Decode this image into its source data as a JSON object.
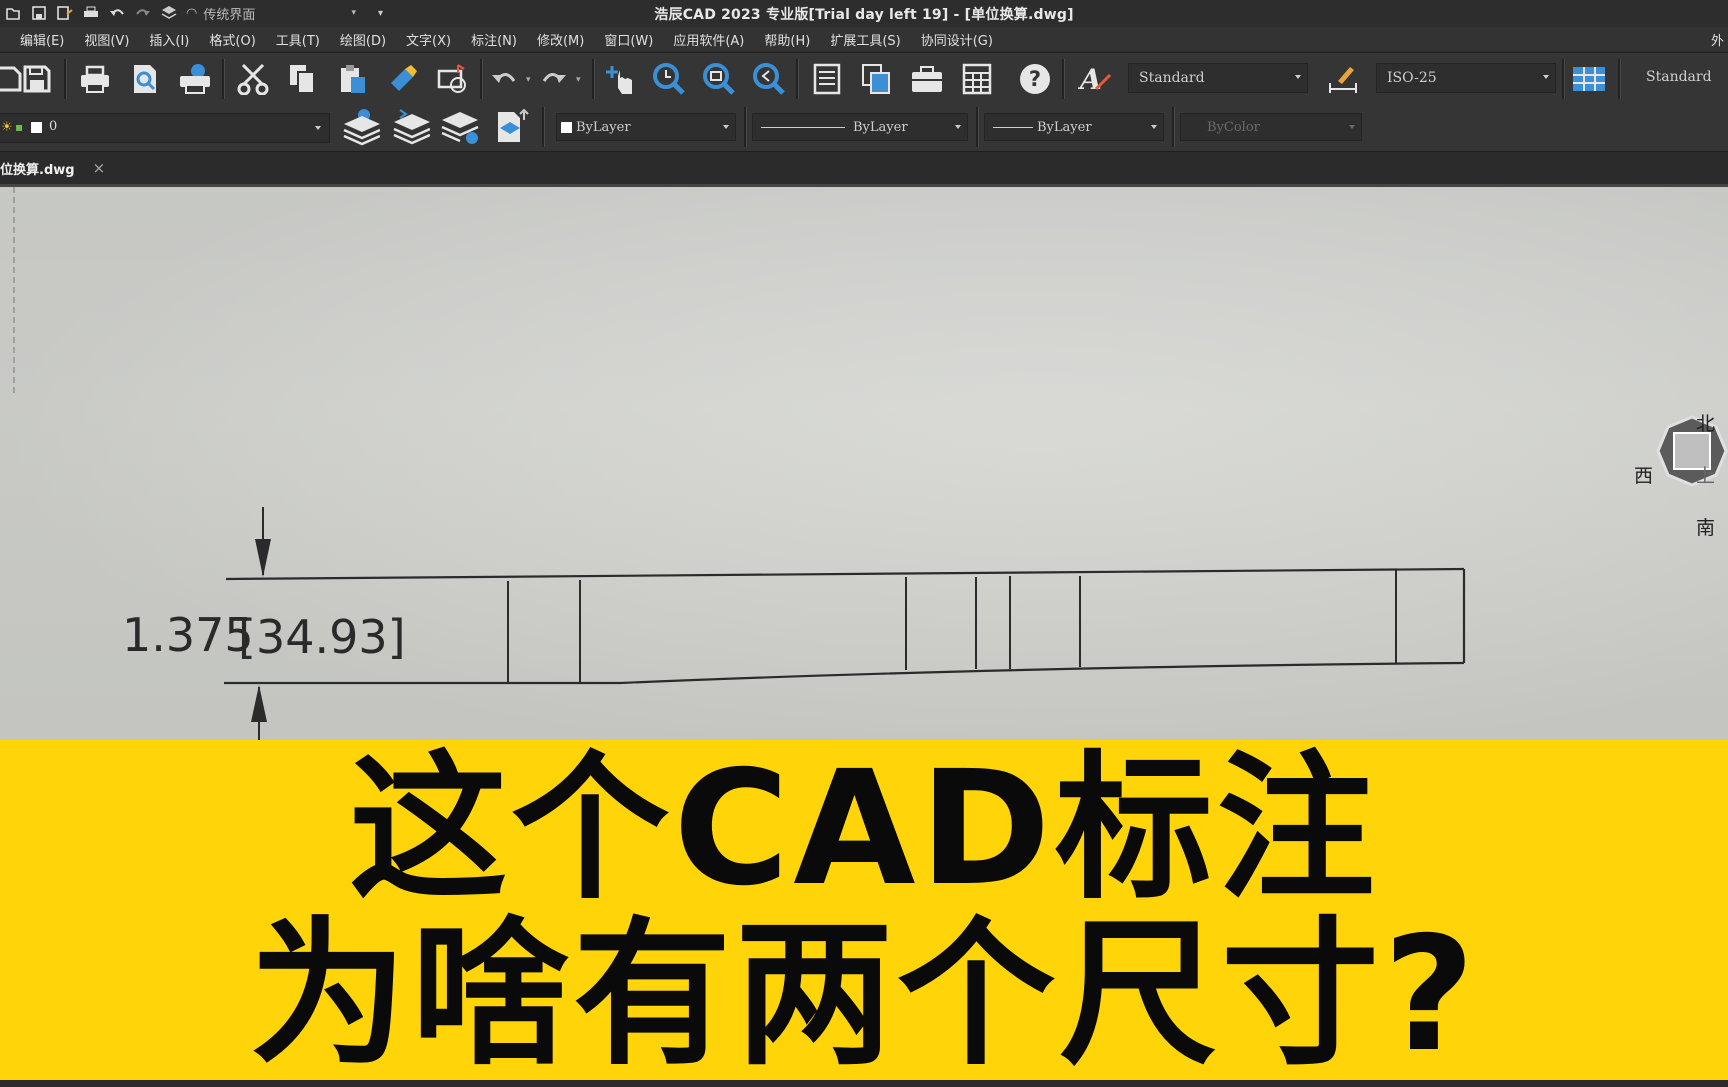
{
  "quick_access": {
    "workspace": "传统界面"
  },
  "window": {
    "title": "浩辰CAD 2023 专业版[Trial day left 19] - [单位换算.dwg]"
  },
  "menu": [
    "编辑(E)",
    "视图(V)",
    "插入(I)",
    "格式(O)",
    "工具(T)",
    "绘图(D)",
    "文字(X)",
    "标注(N)",
    "修改(M)",
    "窗口(W)",
    "应用软件(A)",
    "帮助(H)",
    "扩展工具(S)",
    "协同设计(G)"
  ],
  "menu_right": "外",
  "toolbar": {
    "text_style": "Standard",
    "dim_style": "ISO-25",
    "table_style": "Standard"
  },
  "properties": {
    "layer": "0",
    "color": "ByLayer",
    "linetype": "ByLayer",
    "lineweight": "ByLayer",
    "plot_style": "ByColor"
  },
  "document_tab": {
    "name": "单位换算.dwg",
    "visible_name": "位换算.dwg",
    "close": "×"
  },
  "drawing": {
    "dimension_text": "1.375",
    "alt_dimension_text": "[34.93]"
  },
  "viewcube": {
    "north": "北",
    "west": "西",
    "top": "上",
    "south": "南"
  },
  "banner": {
    "line1": "这个CAD标注",
    "line2": "为啥有两个尺寸?"
  },
  "colors": {
    "banner_bg": "#ffd50a",
    "banner_text": "#0a0a0a",
    "toolbar_bg": "#353535"
  }
}
